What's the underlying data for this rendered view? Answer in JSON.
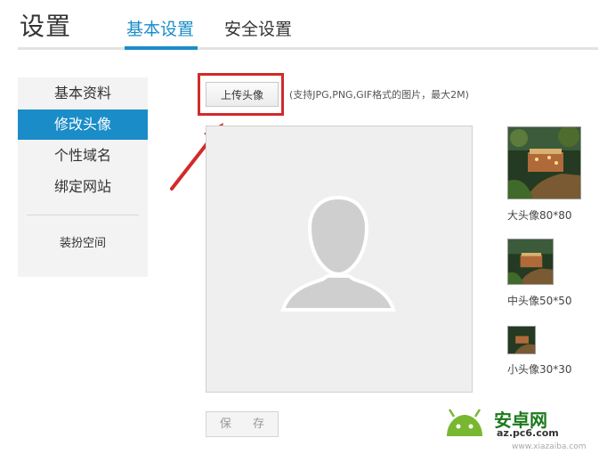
{
  "header": {
    "title": "设置",
    "tabs": [
      {
        "label": "基本设置",
        "active": true
      },
      {
        "label": "安全设置",
        "active": false
      }
    ]
  },
  "sidebar": {
    "items": [
      {
        "label": "基本资料",
        "active": false
      },
      {
        "label": "修改头像",
        "active": true
      },
      {
        "label": "个性域名",
        "active": false
      },
      {
        "label": "绑定网站",
        "active": false
      }
    ],
    "extra_label": "装扮空间"
  },
  "upload": {
    "button_label": "上传头像",
    "hint": "(支持JPG,PNG,GIF格式的图片，最大2M)"
  },
  "previews": {
    "large_label": "大头像80*80",
    "medium_label": "中头像50*50",
    "small_label": "小头像30*30"
  },
  "save_label": "保 存",
  "watermark": {
    "brand": "安卓网",
    "url": "az.pc6.com",
    "url2": "www.xiazaiba.com"
  },
  "colors": {
    "accent": "#1a8dc8",
    "highlight": "#d22a2a",
    "sidebar_bg": "#f3f3f3"
  }
}
